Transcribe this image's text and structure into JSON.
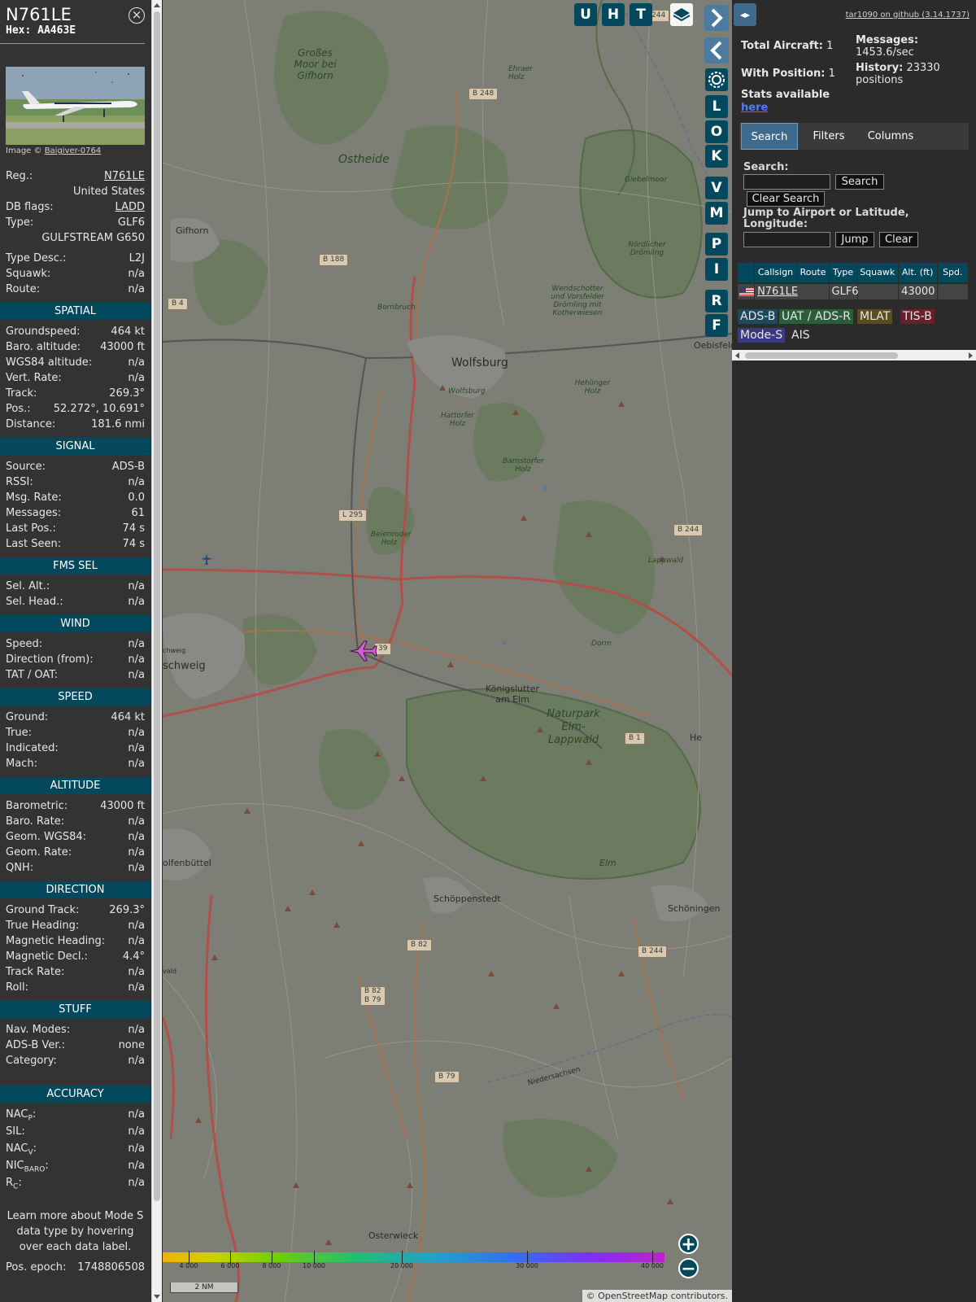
{
  "aircraft": {
    "callsign": "N761LE",
    "hex_label": "Hex: AA463E",
    "photo_credit_prefix": "Image ©",
    "photo_credit_author": "Baigiver-0764"
  },
  "info_rows": [
    {
      "label": "Reg.:",
      "value": "N761LE",
      "link": true
    },
    {
      "label": "",
      "value": "United States"
    },
    {
      "label": "DB flags:",
      "value": "LADD",
      "link": true
    },
    {
      "label": "Type:",
      "value": "GLF6"
    },
    {
      "label": "",
      "value": "GULFSTREAM G650"
    }
  ],
  "info_rows2": [
    {
      "label": "Type Desc.:",
      "value": "L2J"
    },
    {
      "label": "Squawk:",
      "value": "n/a"
    },
    {
      "label": "Route:",
      "value": "n/a"
    }
  ],
  "sections": [
    {
      "title": "SPATIAL",
      "rows": [
        {
          "label": "Groundspeed:",
          "value": "464 kt"
        },
        {
          "label": "Baro. altitude:",
          "value": "43000 ft"
        },
        {
          "label": "WGS84 altitude:",
          "value": "n/a"
        },
        {
          "label": "Vert. Rate:",
          "value": "n/a"
        },
        {
          "label": "Track:",
          "value": "269.3°"
        },
        {
          "label": "Pos.:",
          "value": "52.272°, 10.691°"
        },
        {
          "label": "Distance:",
          "value": "181.6 nmi"
        }
      ]
    },
    {
      "title": "SIGNAL",
      "rows": [
        {
          "label": "Source:",
          "value": "ADS-B"
        },
        {
          "label": "RSSI:",
          "value": "n/a"
        },
        {
          "label": "Msg. Rate:",
          "value": "0.0"
        },
        {
          "label": "Messages:",
          "value": "61"
        },
        {
          "label": "Last Pos.:",
          "value": "74 s"
        },
        {
          "label": "Last Seen:",
          "value": "74 s"
        }
      ]
    },
    {
      "title": "FMS SEL",
      "rows": [
        {
          "label": "Sel. Alt.:",
          "value": "n/a"
        },
        {
          "label": "Sel. Head.:",
          "value": "n/a"
        }
      ]
    },
    {
      "title": "WIND",
      "rows": [
        {
          "label": "Speed:",
          "value": "n/a"
        },
        {
          "label": "Direction (from):",
          "value": "n/a"
        },
        {
          "label": "TAT / OAT:",
          "value": "n/a"
        }
      ]
    },
    {
      "title": "SPEED",
      "rows": [
        {
          "label": "Ground:",
          "value": "464 kt"
        },
        {
          "label": "True:",
          "value": "n/a"
        },
        {
          "label": "Indicated:",
          "value": "n/a"
        },
        {
          "label": "Mach:",
          "value": "n/a"
        }
      ]
    },
    {
      "title": "ALTITUDE",
      "rows": [
        {
          "label": "Barometric:",
          "value": "43000 ft"
        },
        {
          "label": "Baro. Rate:",
          "value": "n/a"
        },
        {
          "label": "Geom. WGS84:",
          "value": "n/a"
        },
        {
          "label": "Geom. Rate:",
          "value": "n/a"
        },
        {
          "label": "QNH:",
          "value": "n/a"
        }
      ]
    },
    {
      "title": "DIRECTION",
      "rows": [
        {
          "label": "Ground Track:",
          "value": "269.3°"
        },
        {
          "label": "True Heading:",
          "value": "n/a"
        },
        {
          "label": "Magnetic Heading:",
          "value": "n/a"
        },
        {
          "label": "Magnetic Decl.:",
          "value": "4.4°"
        },
        {
          "label": "Track Rate:",
          "value": "n/a"
        },
        {
          "label": "Roll:",
          "value": "n/a"
        }
      ]
    },
    {
      "title": "STUFF",
      "rows": [
        {
          "label": "Nav. Modes:",
          "value": "n/a"
        },
        {
          "label": "ADS-B Ver.:",
          "value": "none"
        },
        {
          "label": "Category:",
          "value": "n/a"
        }
      ]
    }
  ],
  "accuracy": {
    "title": "ACCURACY",
    "rows": [
      {
        "label": "NAC",
        "sub": "P",
        "value": "n/a"
      },
      {
        "label": "SIL",
        "sub": "",
        "value": "n/a"
      },
      {
        "label": "NAC",
        "sub": "V",
        "value": "n/a"
      },
      {
        "label": "NIC",
        "sub": "BARO",
        "value": "n/a"
      },
      {
        "label": "R",
        "sub": "C",
        "value": "n/a"
      }
    ],
    "note": "Learn more about Mode S data type by hovering over each data label.",
    "epoch_label": "Pos. epoch:",
    "epoch_value": "1748806508"
  },
  "map": {
    "buttons_top": [
      "U",
      "H",
      "T"
    ],
    "buttons_side": [
      "L",
      "O",
      "K",
      "V",
      "M",
      "P",
      "I",
      "R",
      "F"
    ],
    "labels": {
      "wolfsburg": "Wolfsburg",
      "gifhorn": "Gifhorn",
      "ostheide": "Ostheide",
      "grosses_moor": "Großes Moor bei Gifhorn",
      "ehraer_holz": "Ehraer Holz",
      "giebelmoor": "Giebelmoor",
      "noerdlicher_droemling": "Nördlicher Drömling",
      "wendschotter": "Wendschotter und Vorsfelder Drömling mit Kotherwiesen",
      "bornbruch": "Bornbruch",
      "wolfsburg_small": "Wolfsburg",
      "hehlinger_holz": "Hehlinger Holz",
      "hattorfer_holz": "Hattorfer Holz",
      "barnstorfer_holz": "Barnstorfer Holz",
      "beienroder_holz": "Beienroder Holz",
      "lappwald": "Lappwald",
      "dorm": "Dorm",
      "koenigslutter": "Königslutter am Elm",
      "naturpark": "Naturpark Elm-Lappwald",
      "elm": "Elm",
      "schoeppenstedt": "Schöppenstedt",
      "schoeningen": "Schöningen",
      "osterwieck": "Osterwieck",
      "wolfenbuettel": "olfenbüttel",
      "braunschweig": "schweig",
      "oebisfelde": "Oebisfeld",
      "niedersachsen": "Niedersachsen",
      "he": "He",
      "braunschweig_small": "chweig",
      "wald": "vald"
    },
    "road_signs": [
      "B 248",
      "B 188",
      "B 4",
      "L 295",
      "B 244",
      "B 1",
      "B 82",
      "B 82\nB 79",
      "B 79",
      "B 244",
      "244",
      "39"
    ],
    "altitude_ticks": [
      "4 000",
      "6 000",
      "8 000",
      "10 000",
      "20 000",
      "30 000",
      "40 000"
    ],
    "scale": "2 NM",
    "attribution_prefix": "©",
    "attribution_link": "OpenStreetMap",
    "attribution_suffix": "contributors.",
    "zoom_in": "+",
    "zoom_out": "−"
  },
  "stats": {
    "github_link": "tar1090 on github (3.14.1737)",
    "total_aircraft_label": "Total Aircraft:",
    "total_aircraft": "1",
    "with_position_label": "With Position:",
    "with_position": "1",
    "messages_label": "Messages:",
    "messages_value": "1453.6/sec",
    "history_label": "History:",
    "history_value": "23330 positions",
    "stats_available": "Stats available",
    "stats_link": "here"
  },
  "tabs": [
    "Search",
    "Filters",
    "Columns"
  ],
  "search": {
    "search_label": "Search:",
    "search_button": "Search",
    "clear_search_button": "Clear Search",
    "jump_label": "Jump to Airport or Latitude, Longitude:",
    "jump_button": "Jump",
    "clear_button": "Clear"
  },
  "table": {
    "columns": [
      "",
      "Callsign",
      "Route",
      "Type",
      "Squawk",
      "Alt. (ft)",
      "Spd."
    ],
    "rows": [
      {
        "callsign": "N761LE",
        "route": "",
        "type": "GLF6",
        "squawk": "",
        "alt": "43000",
        "spd": ""
      }
    ]
  },
  "legend": {
    "items": [
      {
        "label": "ADS-B",
        "color": "#1c4a5c"
      },
      {
        "label": "UAT / ADS-R",
        "color": "#2a5d3a"
      },
      {
        "label": "MLAT",
        "color": "#5a4d20"
      },
      {
        "label": "TIS-B",
        "color": "#6a1f2a"
      },
      {
        "label": "Mode-S",
        "color": "#3a3a80"
      },
      {
        "label": "AIS",
        "color": "#2b2b2b"
      }
    ]
  },
  "colors": {
    "accent": "#04485e",
    "panel_bg": "#333333",
    "sidebar_bg": "#2b2b2b",
    "aircraft": "#d060d0"
  }
}
